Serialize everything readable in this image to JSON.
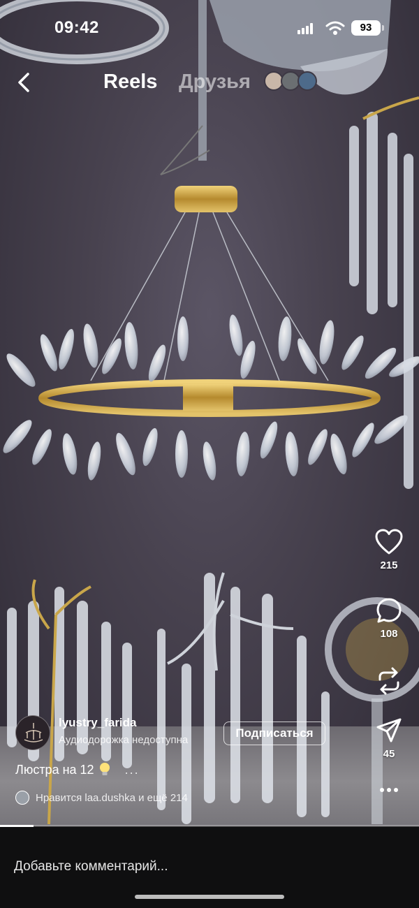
{
  "status_bar": {
    "time": "09:42",
    "battery": "93"
  },
  "header": {
    "tab_reels": "Reels",
    "tab_friends": "Друзья"
  },
  "actions": {
    "like_count": "215",
    "comment_count": "108",
    "share_count": "45"
  },
  "post": {
    "username": "lyustry_farida",
    "audio": "Аудиодорожка недоступна",
    "follow_label": "Подписаться",
    "caption": "Люстра на 12",
    "caption_more": "...",
    "likes_text": "Нравится laa.dushka и ещё 214",
    "progress": 0.08
  },
  "comment_bar": {
    "placeholder": "Добавьте комментарий..."
  },
  "colors": {
    "wall": "#48424f",
    "gold": "#c9a64a",
    "crystal": "#e6ecf2"
  }
}
